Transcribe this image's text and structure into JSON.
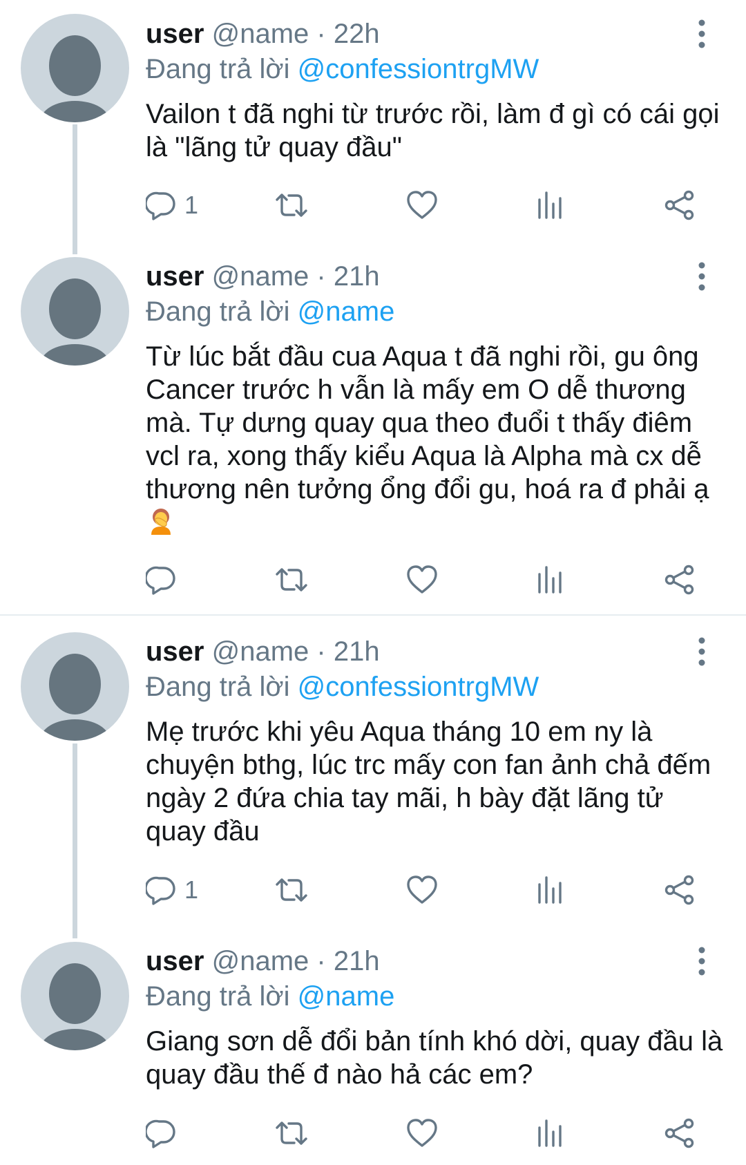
{
  "tweets": [
    {
      "username": "user",
      "handle": "@name",
      "dot": "·",
      "time": "22h",
      "reply_prefix": "Đang trả lời",
      "reply_to": "@confessiontrgMW",
      "text": "Vailon t đã nghi từ trước rồi, làm đ gì có cái gọi là \"lãng tử quay đầu\"",
      "reply_count": "1"
    },
    {
      "username": "user",
      "handle": "@name",
      "dot": "·",
      "time": "21h",
      "reply_prefix": "Đang trả lời",
      "reply_to": "@name",
      "text": "Từ lúc bắt đầu cua Aqua t đã nghi rồi, gu ông Cancer trước h vẫn là mấy em O dễ thương mà. Tự dưng quay qua theo đuổi t thấy điêm vcl ra, xong thấy kiểu Aqua là Alpha mà cx dễ thương nên tưởng ổng đổi gu, hoá ra đ phải ạ",
      "reply_count": ""
    },
    {
      "username": "user",
      "handle": "@name",
      "dot": "·",
      "time": "21h",
      "reply_prefix": "Đang trả lời",
      "reply_to": "@confessiontrgMW",
      "text": "Mẹ trước khi yêu Aqua tháng 10 em ny là chuyện bthg, lúc trc mấy con fan ảnh chả đếm ngày 2 đứa chia tay mãi, h bày đặt lãng tử quay đầu",
      "reply_count": "1"
    },
    {
      "username": "user",
      "handle": "@name",
      "dot": "·",
      "time": "21h",
      "reply_prefix": "Đang trả lời",
      "reply_to": "@name",
      "text": "Giang sơn dễ đổi bản tính khó dời, quay đầu là quay đầu thế đ nào hả các em?",
      "reply_count": ""
    }
  ],
  "emoji_name": "person-facepalming",
  "colors": {
    "link": "#1da1f2",
    "secondary_text": "#657786",
    "avatar_bg": "#ccd6dd",
    "avatar_fg": "#66757f",
    "thread_line": "#ccd6dd"
  }
}
